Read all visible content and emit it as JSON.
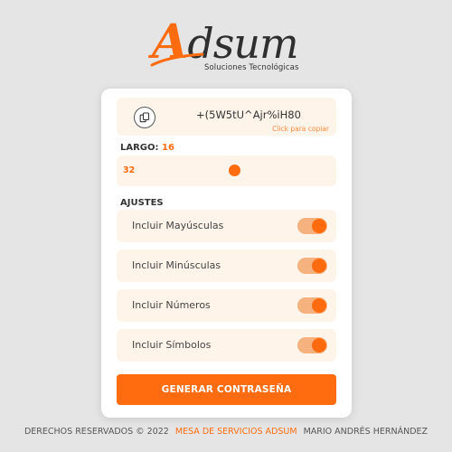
{
  "logo": {
    "brand_initial": "A",
    "brand_rest": "dsum",
    "subtitle": "Soluciones Tecnológicas"
  },
  "generator": {
    "password": "+(5W5tU^Ajr%iH80",
    "copy_hint": "Click para copiar",
    "length_label": "LARGO:",
    "length_value": "16",
    "slider_max": "32",
    "slider_value": 16,
    "settings_title": "AJUSTES",
    "settings": [
      {
        "label": "Incluir Mayúsculas",
        "enabled": true
      },
      {
        "label": "Incluir Minúsculas",
        "enabled": true
      },
      {
        "label": "Incluir Números",
        "enabled": true
      },
      {
        "label": "Incluir Símbolos",
        "enabled": true
      }
    ],
    "generate_label": "GENERAR CONTRASEÑA"
  },
  "footer": {
    "left": "DERECHOS RESERVADOS © 2022",
    "middle": "MESA DE SERVICIOS ADSUM",
    "right": "MARIO ANDRÉS HERNÁNDEZ"
  },
  "colors": {
    "accent": "#ff6b0f",
    "panel": "#fff4ea",
    "background": "#e5e5e5"
  },
  "icons": {
    "copy": "copy-icon"
  }
}
